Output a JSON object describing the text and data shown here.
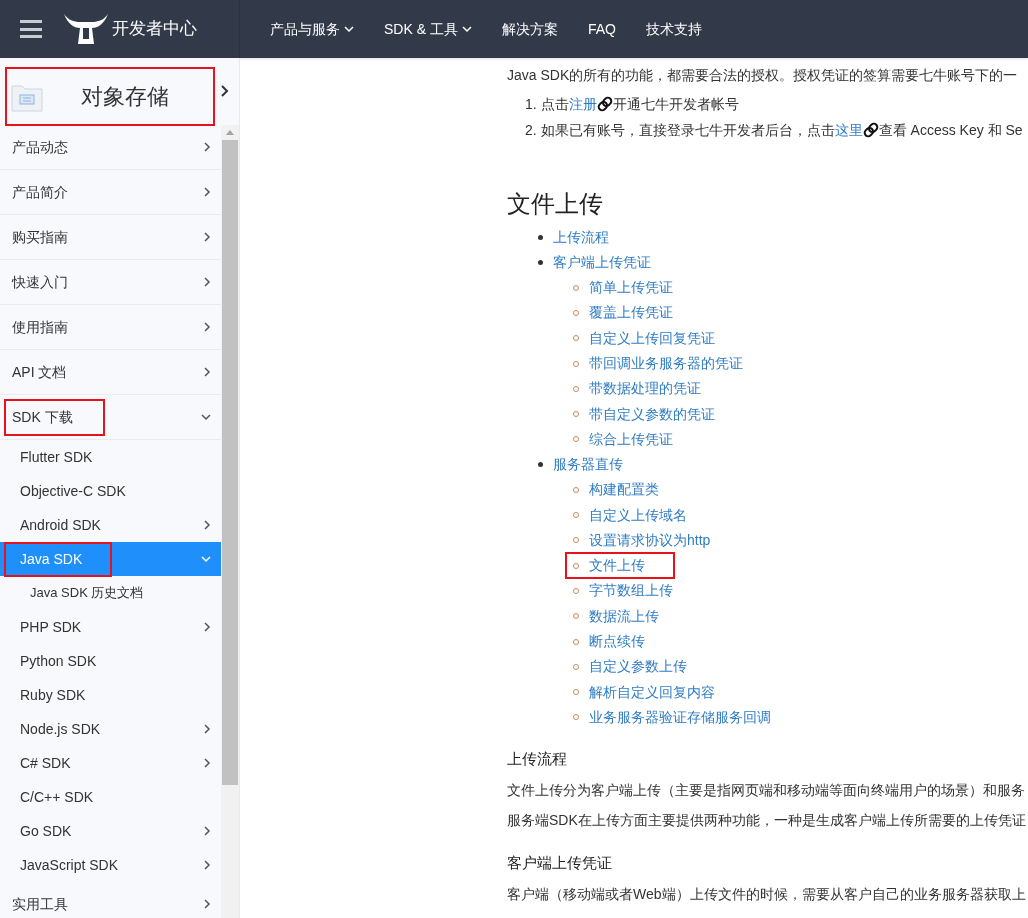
{
  "header": {
    "brand": "开发者中心",
    "nav": [
      {
        "label": "产品与服务",
        "dropdown": true
      },
      {
        "label": "SDK & 工具",
        "dropdown": true
      },
      {
        "label": "解决方案",
        "dropdown": false
      },
      {
        "label": "FAQ",
        "dropdown": false
      },
      {
        "label": "技术支持",
        "dropdown": false
      }
    ]
  },
  "sidebar": {
    "title": "对象存储",
    "title_highlighted": true,
    "items": [
      {
        "label": "产品动态",
        "expandable": true,
        "expanded": false,
        "selected": false,
        "highlighted": false
      },
      {
        "label": "产品简介",
        "expandable": true,
        "expanded": false,
        "selected": false,
        "highlighted": false
      },
      {
        "label": "购买指南",
        "expandable": true,
        "expanded": false,
        "selected": false,
        "highlighted": false
      },
      {
        "label": "快速入门",
        "expandable": true,
        "expanded": false,
        "selected": false,
        "highlighted": false
      },
      {
        "label": "使用指南",
        "expandable": true,
        "expanded": false,
        "selected": false,
        "highlighted": false
      },
      {
        "label": "API 文档",
        "expandable": true,
        "expanded": false,
        "selected": false,
        "highlighted": false
      },
      {
        "label": "SDK 下载",
        "expandable": true,
        "expanded": true,
        "selected": false,
        "highlighted": true,
        "children": [
          {
            "label": "Flutter SDK",
            "expandable": false,
            "expanded": false,
            "selected": false,
            "highlighted": false
          },
          {
            "label": "Objective-C SDK",
            "expandable": false,
            "expanded": false,
            "selected": false,
            "highlighted": false
          },
          {
            "label": "Android SDK",
            "expandable": true,
            "expanded": false,
            "selected": false,
            "highlighted": false
          },
          {
            "label": "Java SDK",
            "expandable": true,
            "expanded": true,
            "selected": true,
            "highlighted": true,
            "children": [
              {
                "label": "Java SDK 历史文档",
                "expandable": false,
                "expanded": false,
                "selected": false,
                "highlighted": false
              }
            ]
          },
          {
            "label": "PHP SDK",
            "expandable": true,
            "expanded": false,
            "selected": false,
            "highlighted": false
          },
          {
            "label": "Python SDK",
            "expandable": false,
            "expanded": false,
            "selected": false,
            "highlighted": false
          },
          {
            "label": "Ruby SDK",
            "expandable": false,
            "expanded": false,
            "selected": false,
            "highlighted": false
          },
          {
            "label": "Node.js SDK",
            "expandable": true,
            "expanded": false,
            "selected": false,
            "highlighted": false
          },
          {
            "label": "C# SDK",
            "expandable": true,
            "expanded": false,
            "selected": false,
            "highlighted": false
          },
          {
            "label": "C/C++ SDK",
            "expandable": false,
            "expanded": false,
            "selected": false,
            "highlighted": false
          },
          {
            "label": "Go SDK",
            "expandable": true,
            "expanded": false,
            "selected": false,
            "highlighted": false
          },
          {
            "label": "JavaScript SDK",
            "expandable": true,
            "expanded": false,
            "selected": false,
            "highlighted": false
          }
        ]
      },
      {
        "label": "实用工具",
        "expandable": true,
        "expanded": false,
        "selected": false,
        "highlighted": false
      }
    ]
  },
  "content": {
    "intro": "Java SDK的所有的功能，都需要合法的授权。授权凭证的签算需要七牛账号下的一",
    "steps": [
      {
        "number": "1.",
        "before": "点击",
        "link": "注册",
        "after": "开通七牛开发者帐号"
      },
      {
        "number": "2.",
        "before": "如果已有账号，直接登录七牛开发者后台，点击",
        "link": "这里",
        "after": "查看 Access Key 和 Se"
      }
    ],
    "heading": "文件上传",
    "toc": [
      {
        "label": "上传流程",
        "highlighted": false
      },
      {
        "label": "客户端上传凭证",
        "highlighted": false,
        "children": [
          {
            "label": "简单上传凭证",
            "highlighted": false
          },
          {
            "label": "覆盖上传凭证",
            "highlighted": false
          },
          {
            "label": "自定义上传回复凭证",
            "highlighted": false
          },
          {
            "label": "带回调业务服务器的凭证",
            "highlighted": false
          },
          {
            "label": "带数据处理的凭证",
            "highlighted": false
          },
          {
            "label": "带自定义参数的凭证",
            "highlighted": false
          },
          {
            "label": "综合上传凭证",
            "highlighted": false
          }
        ]
      },
      {
        "label": "服务器直传",
        "highlighted": false,
        "children": [
          {
            "label": "构建配置类",
            "highlighted": false
          },
          {
            "label": "自定义上传域名",
            "highlighted": false
          },
          {
            "label": "设置请求协议为http",
            "highlighted": false
          },
          {
            "label": "文件上传",
            "highlighted": true
          },
          {
            "label": "字节数组上传",
            "highlighted": false
          },
          {
            "label": "数据流上传",
            "highlighted": false
          },
          {
            "label": "断点续传",
            "highlighted": false
          },
          {
            "label": "自定义参数上传",
            "highlighted": false
          },
          {
            "label": "解析自定义回复内容",
            "highlighted": false
          },
          {
            "label": "业务服务器验证存储服务回调",
            "highlighted": false
          }
        ]
      }
    ],
    "sections": [
      {
        "title": "上传流程",
        "paragraphs": [
          "文件上传分为客户端上传（主要是指网页端和移动端等面向终端用户的场景）和服务",
          "服务端SDK在上传方面主要提供两种功能，一种是生成客户端上传所需要的上传凭证"
        ]
      },
      {
        "title": "客户端上传凭证",
        "paragraphs": [
          "客户端（移动端或者Web端）上传文件的时候，需要从客户自己的业务服务器获取上"
        ]
      }
    ]
  }
}
